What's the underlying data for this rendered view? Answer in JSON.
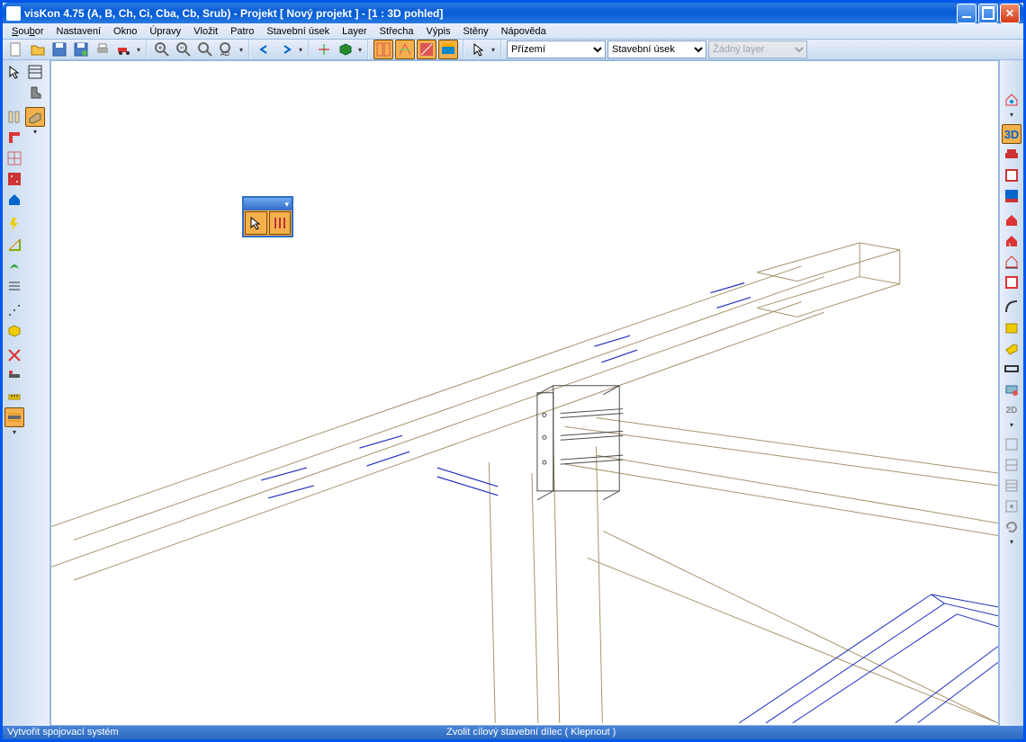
{
  "title": "visKon 4.75 (A, B, Ch, Ci, Cba, Cb, Srub) - Projekt [ Nový projekt ]  - [1 : 3D pohled]",
  "menu": {
    "soubor": "Soubor",
    "nastaveni": "Nastavení",
    "okno": "Okno",
    "upravy": "Úpravy",
    "vlozit": "Vložit",
    "patro": "Patro",
    "stavebni_usek": "Stavební úsek",
    "layer": "Layer",
    "strecha": "Střecha",
    "vypis": "Výpis",
    "steny": "Stěny",
    "napoveda": "Nápověda"
  },
  "combos": {
    "floor": "Přízemí",
    "section": "Stavební úsek",
    "layer": "Žádný layer"
  },
  "status": {
    "left": "Vytvořit spojovací systém",
    "center": "Zvolit cílový stavební dílec ( Klepnout )"
  },
  "right_3d": "3D"
}
